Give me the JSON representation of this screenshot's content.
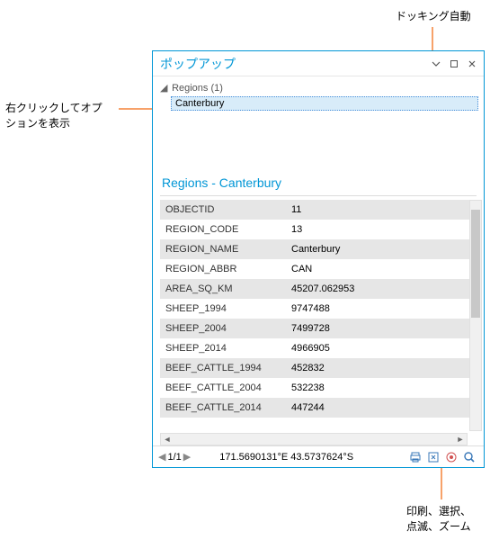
{
  "annotations": {
    "top": "ドッキング自動",
    "left_line1": "右クリックしてオプ",
    "left_line2": "ションを表示",
    "bottom_line1": "印刷、選択、",
    "bottom_line2": "点滅、ズーム"
  },
  "panel": {
    "title": "ポップアップ",
    "tree": {
      "header_label": "Regions",
      "header_count": "(1)",
      "selected_item": "Canterbury"
    },
    "detail_title": "Regions - Canterbury",
    "rows": [
      {
        "k": "OBJECTID",
        "v": "11"
      },
      {
        "k": "REGION_CODE",
        "v": "13"
      },
      {
        "k": "REGION_NAME",
        "v": "Canterbury"
      },
      {
        "k": "REGION_ABBR",
        "v": "CAN"
      },
      {
        "k": "AREA_SQ_KM",
        "v": "45207.062953"
      },
      {
        "k": "SHEEP_1994",
        "v": "9747488"
      },
      {
        "k": "SHEEP_2004",
        "v": "7499728"
      },
      {
        "k": "SHEEP_2014",
        "v": "4966905"
      },
      {
        "k": "BEEF_CATTLE_1994",
        "v": "452832"
      },
      {
        "k": "BEEF_CATTLE_2004",
        "v": "532238"
      },
      {
        "k": "BEEF_CATTLE_2014",
        "v": "447244"
      }
    ],
    "status": {
      "page": "1/1",
      "coords": "171.5690131°E 43.5737624°S"
    }
  },
  "icons": {
    "dock_menu": "▾",
    "restore": "▢",
    "close": "✕",
    "prev": "◀",
    "next": "▶",
    "print": "print-icon",
    "select": "select-icon",
    "flash": "flash-icon",
    "zoom": "zoom-icon"
  }
}
